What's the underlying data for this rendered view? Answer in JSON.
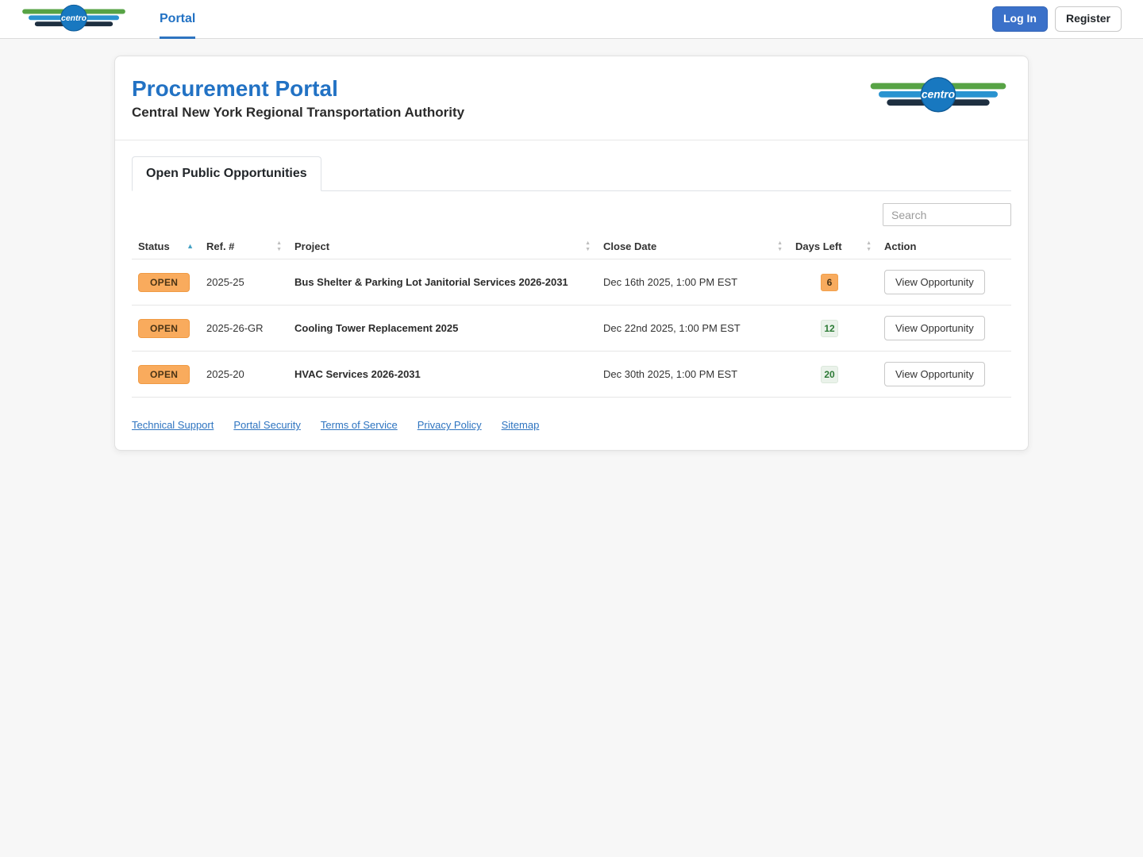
{
  "navbar": {
    "brand": "centro",
    "portal_link": "Portal",
    "login_label": "Log In",
    "register_label": "Register"
  },
  "header": {
    "title": "Procurement Portal",
    "subtitle": "Central New York Regional Transportation Authority"
  },
  "tabs": [
    {
      "label": "Open Public Opportunities",
      "active": true
    }
  ],
  "search": {
    "placeholder": "Search"
  },
  "icons": {
    "sort_up": "▲",
    "sort_down": "▼",
    "sorted_asc": "▲"
  },
  "table": {
    "columns": [
      {
        "label": "Status",
        "sorted": "asc"
      },
      {
        "label": "Ref. #",
        "sorted": "none"
      },
      {
        "label": "Project",
        "sorted": "none"
      },
      {
        "label": "Close Date",
        "sorted": "none"
      },
      {
        "label": "Days Left",
        "sorted": "none"
      },
      {
        "label": "Action",
        "sorted": null
      }
    ],
    "rows": [
      {
        "status": "OPEN",
        "ref": "2025-25",
        "project": "Bus Shelter & Parking Lot Janitorial Services 2026-2031",
        "close_date": "Dec 16th 2025, 1:00 PM EST",
        "days_left": "6",
        "days_left_style": "warning",
        "action": "View Opportunity"
      },
      {
        "status": "OPEN",
        "ref": "2025-26-GR",
        "project": "Cooling Tower Replacement 2025",
        "close_date": "Dec 22nd 2025, 1:00 PM EST",
        "days_left": "12",
        "days_left_style": "success",
        "action": "View Opportunity"
      },
      {
        "status": "OPEN",
        "ref": "2025-20",
        "project": "HVAC Services 2026-2031",
        "close_date": "Dec 30th 2025, 1:00 PM EST",
        "days_left": "20",
        "days_left_style": "success",
        "action": "View Opportunity"
      }
    ]
  },
  "footer": {
    "links": [
      "Technical Support",
      "Portal Security",
      "Terms of Service",
      "Privacy Policy",
      "Sitemap"
    ]
  },
  "colors": {
    "accent_blue": "#2272c4",
    "login_button_blue": "#3b71c9",
    "badge_orange_bg": "#f9ab5d",
    "badge_green_bg": "#eaf2ea",
    "badge_green_text": "#2c7a35",
    "logo_green": "#57a345",
    "logo_blue": "#2a93d0",
    "logo_navy": "#1e2f40",
    "logo_circle_blue": "#1878c0"
  }
}
